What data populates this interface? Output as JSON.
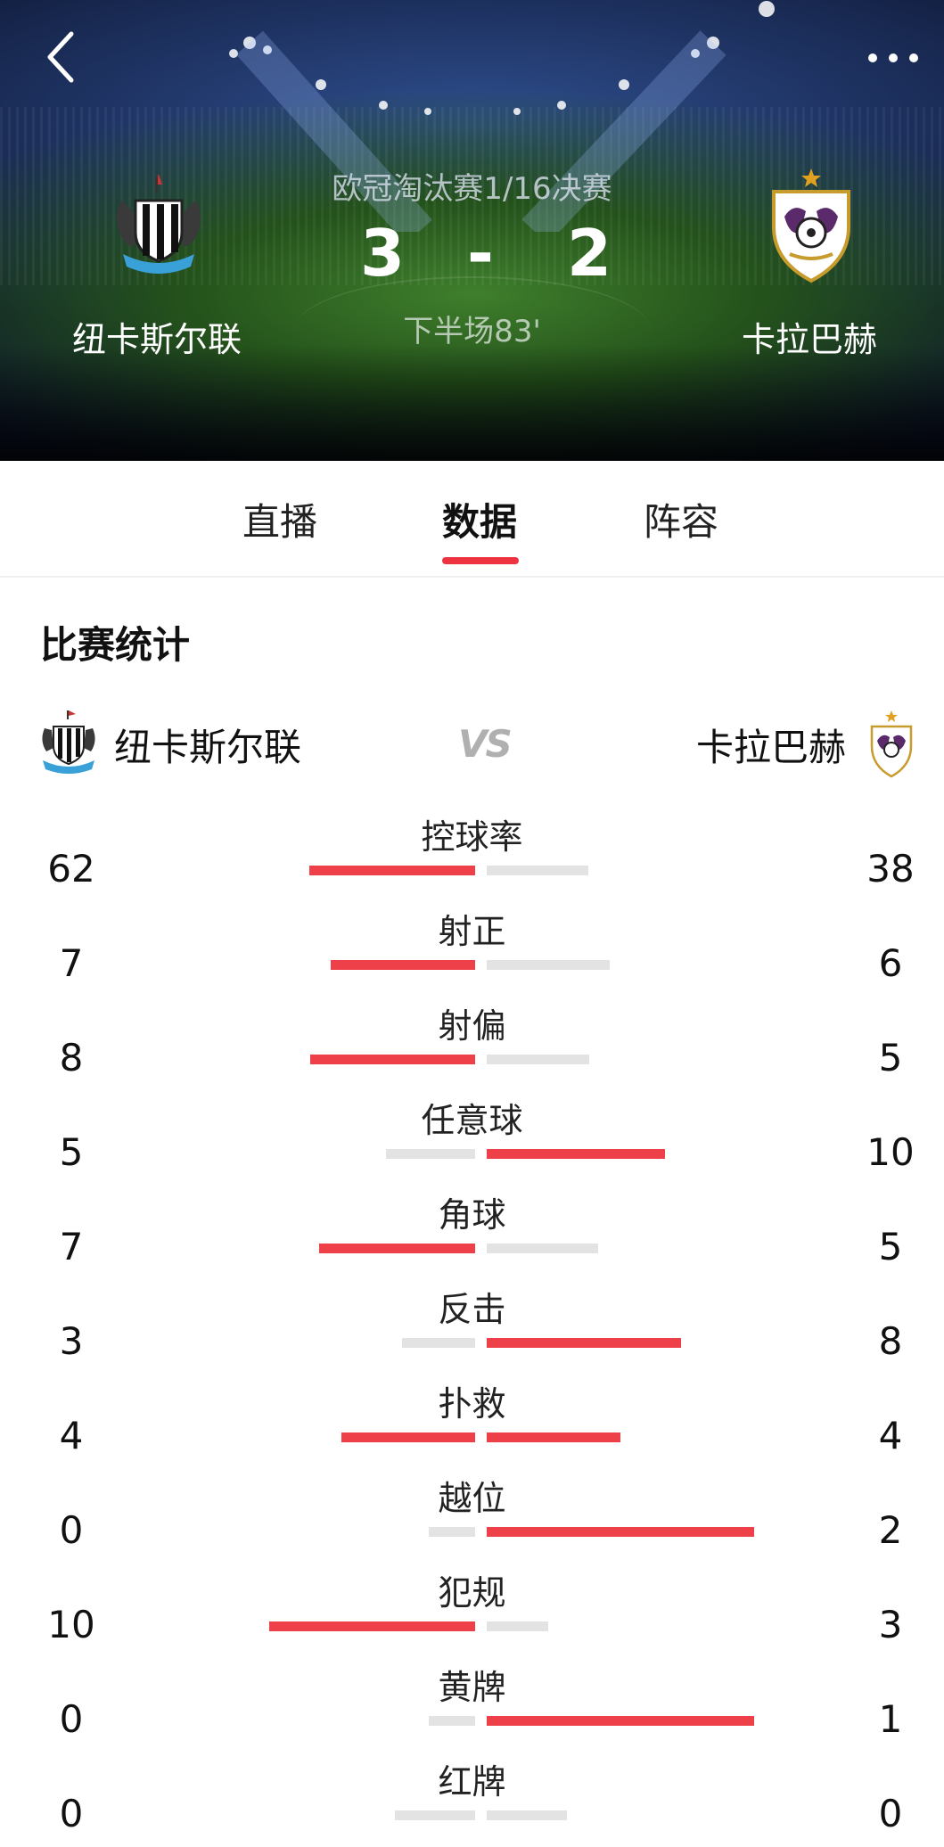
{
  "header": {
    "competition": "欧冠淘汰赛1/16决赛",
    "home_score": "3",
    "dash": "-",
    "away_score": "2",
    "status": "下半场83'",
    "home_team": "纽卡斯尔联",
    "away_team": "卡拉巴赫"
  },
  "tabs": [
    {
      "label": "直播"
    },
    {
      "label": "数据"
    },
    {
      "label": "阵容"
    }
  ],
  "active_tab": "数据",
  "section_title": "比赛统计",
  "teams_row": {
    "home_name": "纽卡斯尔联",
    "vs": "VS",
    "away_name": "卡拉巴赫"
  },
  "colors": {
    "accent": "#ee3340",
    "bar_winner": "#ee4048",
    "bar_loser": "#e3e3e3"
  },
  "icons": {
    "back": "chevron-left-icon",
    "more": "more-horizontal-icon"
  },
  "stats": [
    {
      "label": "控球率",
      "home": 62,
      "away": 38
    },
    {
      "label": "射正",
      "home": 7,
      "away": 6
    },
    {
      "label": "射偏",
      "home": 8,
      "away": 5
    },
    {
      "label": "任意球",
      "home": 5,
      "away": 10
    },
    {
      "label": "角球",
      "home": 7,
      "away": 5
    },
    {
      "label": "反击",
      "home": 3,
      "away": 8
    },
    {
      "label": "扑救",
      "home": 4,
      "away": 4
    },
    {
      "label": "越位",
      "home": 0,
      "away": 2
    },
    {
      "label": "犯规",
      "home": 10,
      "away": 3
    },
    {
      "label": "黄牌",
      "home": 0,
      "away": 1
    },
    {
      "label": "红牌",
      "home": 0,
      "away": 0
    }
  ]
}
